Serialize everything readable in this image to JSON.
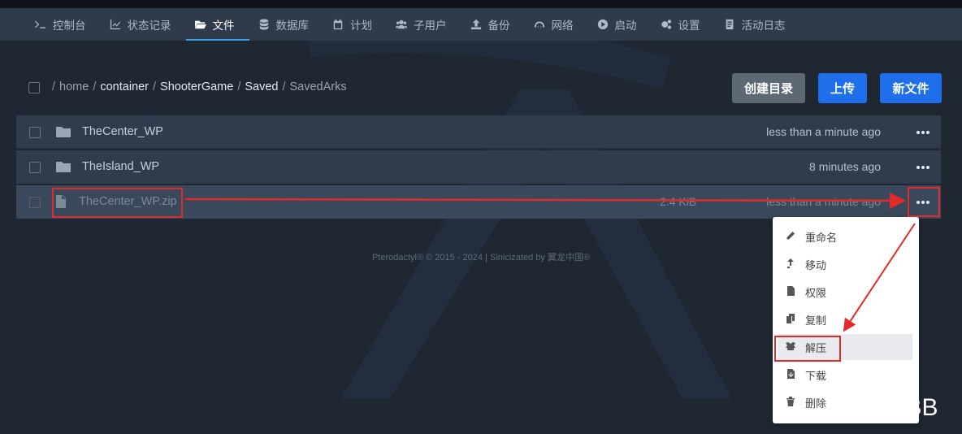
{
  "nav": {
    "items": [
      {
        "label": "控制台",
        "icon": "terminal-icon",
        "active": false
      },
      {
        "label": "状态记录",
        "icon": "chart-icon",
        "active": false
      },
      {
        "label": "文件",
        "icon": "folder-open-icon",
        "active": true
      },
      {
        "label": "数据库",
        "icon": "database-icon",
        "active": false
      },
      {
        "label": "计划",
        "icon": "calendar-icon",
        "active": false
      },
      {
        "label": "子用户",
        "icon": "users-icon",
        "active": false
      },
      {
        "label": "备份",
        "icon": "upload-icon",
        "active": false
      },
      {
        "label": "网络",
        "icon": "network-icon",
        "active": false
      },
      {
        "label": "启动",
        "icon": "play-icon",
        "active": false
      },
      {
        "label": "设置",
        "icon": "gears-icon",
        "active": false
      },
      {
        "label": "活动日志",
        "icon": "log-icon",
        "active": false
      }
    ]
  },
  "breadcrumb": {
    "parts": [
      "home",
      "container",
      "ShooterGame",
      "Saved",
      "SavedArks"
    ]
  },
  "toolbar": {
    "create_dir": "创建目录",
    "upload": "上传",
    "new_file": "新文件"
  },
  "files": [
    {
      "name": "TheCenter_WP",
      "type": "folder",
      "size": "",
      "modified": "less than a minute ago"
    },
    {
      "name": "TheIsland_WP",
      "type": "folder",
      "size": "",
      "modified": "8 minutes ago"
    },
    {
      "name": "TheCenter_WP.zip",
      "type": "file",
      "size": "2.4 KiB",
      "modified": "less than a minute ago"
    }
  ],
  "footer": {
    "text": "Pterodactyl® © 2015 - 2024 | Sinicizated by 翼龙中国®"
  },
  "context_menu": {
    "items": [
      {
        "label": "重命名",
        "icon": "pencil-icon"
      },
      {
        "label": "移动",
        "icon": "move-arrow-icon"
      },
      {
        "label": "权限",
        "icon": "file-lock-icon"
      },
      {
        "label": "复制",
        "icon": "copy-icon"
      },
      {
        "label": "解压",
        "icon": "box-open-icon"
      },
      {
        "label": "下载",
        "icon": "file-download-icon"
      },
      {
        "label": "删除",
        "icon": "trash-icon"
      }
    ]
  },
  "watermark": {
    "text": "@大BB"
  },
  "colors": {
    "accent": "#1f6feb",
    "annotation": "#e12b2b",
    "nav_bg": "#2f3b4b",
    "page_bg": "#1f2733"
  }
}
